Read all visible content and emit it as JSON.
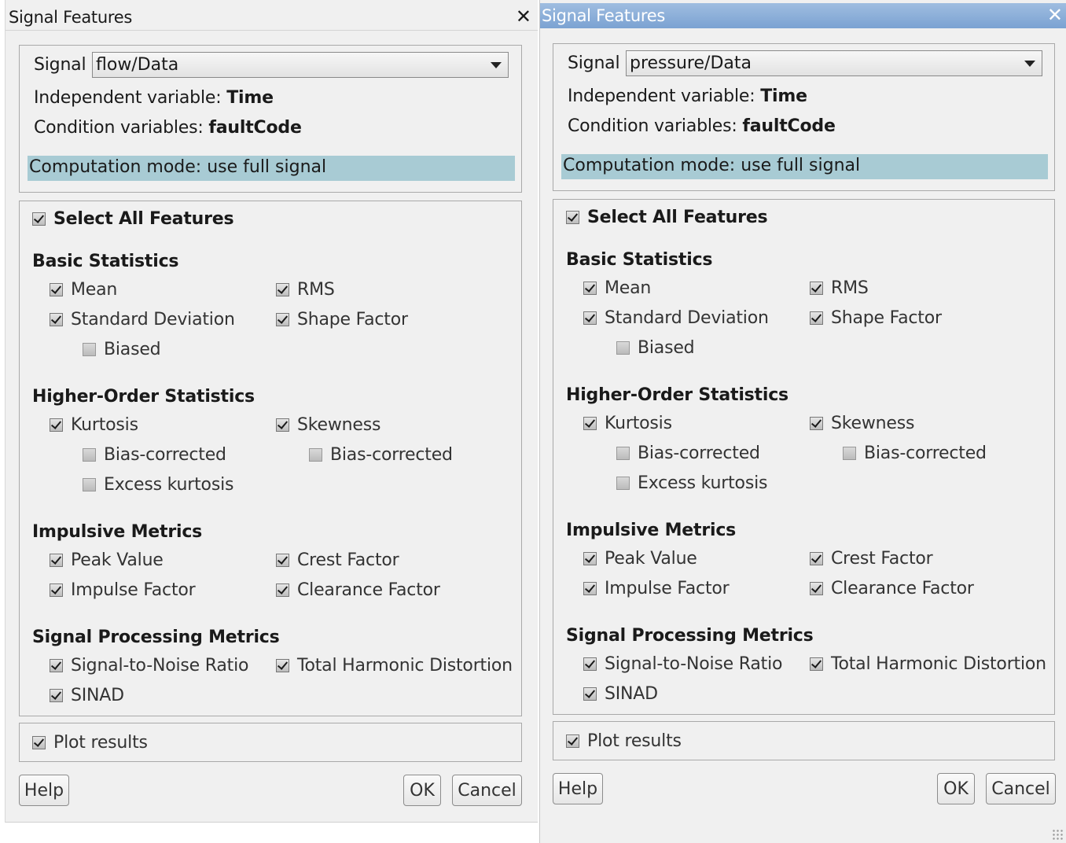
{
  "dialogs": [
    {
      "title": "Signal Features",
      "close_glyph": "✕",
      "signal_label": "Signal",
      "signal_value": "flow/Data",
      "independent_label": "Independent variable: ",
      "independent_value": "Time",
      "condition_label": "Condition variables: ",
      "condition_value": "faultCode",
      "computation_mode": "Computation mode: use full signal",
      "select_all": {
        "label": "Select All Features",
        "checked": true
      },
      "basic": {
        "heading": "Basic Statistics",
        "mean": {
          "label": "Mean",
          "checked": true
        },
        "rms": {
          "label": "RMS",
          "checked": true
        },
        "std": {
          "label": "Standard Deviation",
          "checked": true
        },
        "shape": {
          "label": "Shape Factor",
          "checked": true
        },
        "biased": {
          "label": "Biased",
          "checked": false
        }
      },
      "higher": {
        "heading": "Higher-Order Statistics",
        "kurtosis": {
          "label": "Kurtosis",
          "checked": true
        },
        "skewness": {
          "label": "Skewness",
          "checked": true
        },
        "kurt_bias": {
          "label": "Bias-corrected",
          "checked": false
        },
        "skew_bias": {
          "label": "Bias-corrected",
          "checked": false
        },
        "excess": {
          "label": "Excess kurtosis",
          "checked": false
        }
      },
      "impulsive": {
        "heading": "Impulsive Metrics",
        "peak": {
          "label": "Peak Value",
          "checked": true
        },
        "crest": {
          "label": "Crest Factor",
          "checked": true
        },
        "impulse": {
          "label": "Impulse Factor",
          "checked": true
        },
        "clearance": {
          "label": "Clearance Factor",
          "checked": true
        }
      },
      "processing": {
        "heading": "Signal Processing Metrics",
        "snr": {
          "label": "Signal-to-Noise Ratio",
          "checked": true
        },
        "thd": {
          "label": "Total Harmonic Distortion",
          "checked": true
        },
        "sinad": {
          "label": "SINAD",
          "checked": true
        }
      },
      "plot_results": {
        "label": "Plot results",
        "checked": true
      },
      "buttons": {
        "help": "Help",
        "ok": "OK",
        "cancel": "Cancel"
      }
    },
    {
      "title": "Signal Features",
      "close_glyph": "✕",
      "signal_label": "Signal",
      "signal_value": "pressure/Data",
      "independent_label": "Independent variable: ",
      "independent_value": "Time",
      "condition_label": "Condition variables: ",
      "condition_value": "faultCode",
      "computation_mode": "Computation mode: use full signal",
      "select_all": {
        "label": "Select All Features",
        "checked": true
      },
      "basic": {
        "heading": "Basic Statistics",
        "mean": {
          "label": "Mean",
          "checked": true
        },
        "rms": {
          "label": "RMS",
          "checked": true
        },
        "std": {
          "label": "Standard Deviation",
          "checked": true
        },
        "shape": {
          "label": "Shape Factor",
          "checked": true
        },
        "biased": {
          "label": "Biased",
          "checked": false
        }
      },
      "higher": {
        "heading": "Higher-Order Statistics",
        "kurtosis": {
          "label": "Kurtosis",
          "checked": true
        },
        "skewness": {
          "label": "Skewness",
          "checked": true
        },
        "kurt_bias": {
          "label": "Bias-corrected",
          "checked": false
        },
        "skew_bias": {
          "label": "Bias-corrected",
          "checked": false
        },
        "excess": {
          "label": "Excess kurtosis",
          "checked": false
        }
      },
      "impulsive": {
        "heading": "Impulsive Metrics",
        "peak": {
          "label": "Peak Value",
          "checked": true
        },
        "crest": {
          "label": "Crest Factor",
          "checked": true
        },
        "impulse": {
          "label": "Impulse Factor",
          "checked": true
        },
        "clearance": {
          "label": "Clearance Factor",
          "checked": true
        }
      },
      "processing": {
        "heading": "Signal Processing Metrics",
        "snr": {
          "label": "Signal-to-Noise Ratio",
          "checked": true
        },
        "thd": {
          "label": "Total Harmonic Distortion",
          "checked": true
        },
        "sinad": {
          "label": "SINAD",
          "checked": true
        }
      },
      "plot_results": {
        "label": "Plot results",
        "checked": true
      },
      "buttons": {
        "help": "Help",
        "ok": "OK",
        "cancel": "Cancel"
      }
    }
  ],
  "colors": {
    "mode_bar": "#a8cbd4",
    "active_title_bar": "#86aad6"
  }
}
